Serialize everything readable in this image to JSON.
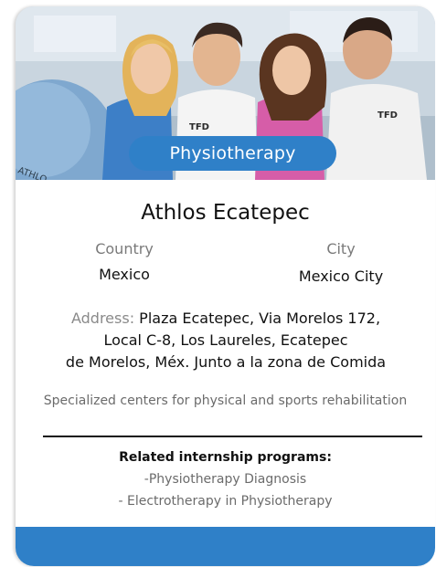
{
  "card": {
    "category_label": "Physiotherapy",
    "title": "Athlos Ecatepec",
    "country": {
      "label": "Country",
      "value": "Mexico"
    },
    "city": {
      "label": "City",
      "value": "Mexico City"
    },
    "address": {
      "label": "Address:",
      "line1": "Plaza Ecatepec, Via Morelos 172,",
      "line2": "Local C-8, Los Laureles, Ecatepec",
      "line3": "de Morelos, Méx. Junto a la zona de Comida"
    },
    "description": "Specialized centers for physical and sports rehabilitation",
    "related": {
      "title": "Related internship programs:",
      "items": [
        "-Physiotherapy Diagnosis",
        "- Electrotherapy in Physiotherapy"
      ]
    }
  },
  "hero_image": {
    "shirt_logo_text": "TFD",
    "ball_text": "ATHLO"
  },
  "colors": {
    "accent": "#2f80c8",
    "text": "#111111",
    "muted": "#7a7a7a"
  }
}
